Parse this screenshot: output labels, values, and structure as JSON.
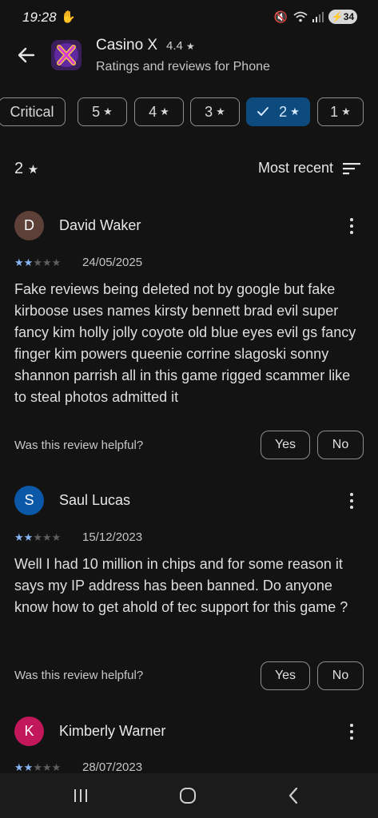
{
  "status": {
    "time": "19:28",
    "battery": "34",
    "notification_icon": "hand-icon",
    "icons": [
      "mute-icon",
      "wifi-icon",
      "signal-icon"
    ]
  },
  "header": {
    "app_name": "Casino X",
    "app_rating": "4.4",
    "subtitle": "Ratings and reviews for Phone",
    "icon_letter": "X"
  },
  "filters": {
    "chips": [
      {
        "label": "Critical",
        "star": false,
        "selected": false
      },
      {
        "label": "5",
        "star": true,
        "selected": false
      },
      {
        "label": "4",
        "star": true,
        "selected": false
      },
      {
        "label": "3",
        "star": true,
        "selected": false
      },
      {
        "label": "2",
        "star": true,
        "selected": true
      },
      {
        "label": "1",
        "star": true,
        "selected": false
      }
    ]
  },
  "sort": {
    "count_label": "2",
    "order_label": "Most recent"
  },
  "reviews": [
    {
      "initial": "D",
      "avatar_color": "#5d4037",
      "name": "David Waker",
      "stars": 2,
      "date": "24/05/2025",
      "text": "Fake reviews being deleted not by google but fake kirboose uses names kirsty bennett brad evil super fancy kim holly jolly coyote old blue eyes evil gs fancy finger kim powers queenie corrine slagoski sonny shannon parrish all in this game rigged scammer like to steal photos admitted it",
      "helpful_prompt": "Was this review helpful?",
      "yes_label": "Yes",
      "no_label": "No"
    },
    {
      "initial": "S",
      "avatar_color": "#0b57a8",
      "name": "Saul Lucas",
      "stars": 2,
      "date": "15/12/2023",
      "text": "Well I had 10 million in chips and for some reason it says my IP address has been banned. Do anyone know how to get ahold of tec support for this game ?",
      "helpful_prompt": "Was this review helpful?",
      "yes_label": "Yes",
      "no_label": "No"
    },
    {
      "initial": "K",
      "avatar_color": "#c2185b",
      "name": "Kimberly Warner",
      "stars": 2,
      "date": "28/07/2023"
    }
  ],
  "colors": {
    "background": "#131313",
    "accent_chip": "#0d4a7e",
    "star_on": "#8ab4f8"
  }
}
